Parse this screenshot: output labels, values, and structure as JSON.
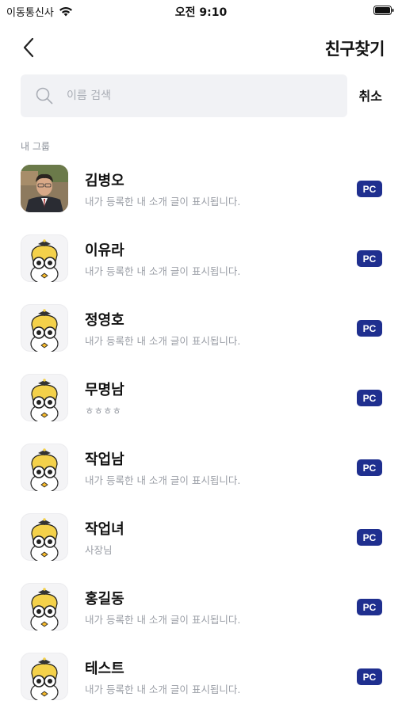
{
  "status_bar": {
    "carrier": "이동통신사",
    "time": "오전 9:10"
  },
  "nav": {
    "title": "친구찾기"
  },
  "search": {
    "placeholder": "이름 검색",
    "value": "",
    "cancel_label": "취소"
  },
  "section_label": "내 그룹",
  "friends": [
    {
      "name": "김병오",
      "intro": "내가 등록한 내 소개 글이 표시됩니다.",
      "badge": "PC",
      "avatar": "photo-avatar"
    },
    {
      "name": "이유라",
      "intro": "내가 등록한 내 소개 글이 표시됩니다.",
      "badge": "PC",
      "avatar": "mascot-avatar"
    },
    {
      "name": "정영호",
      "intro": "내가 등록한 내 소개 글이 표시됩니다.",
      "badge": "PC",
      "avatar": "mascot-avatar"
    },
    {
      "name": "무명남",
      "intro": "ㅎㅎㅎㅎ",
      "badge": "PC",
      "avatar": "mascot-avatar"
    },
    {
      "name": "작업남",
      "intro": "내가 등록한 내 소개 글이 표시됩니다.",
      "badge": "PC",
      "avatar": "mascot-avatar"
    },
    {
      "name": "작업녀",
      "intro": "사장님",
      "badge": "PC",
      "avatar": "mascot-avatar"
    },
    {
      "name": "홍길동",
      "intro": "내가 등록한 내 소개 글이 표시됩니다.",
      "badge": "PC",
      "avatar": "mascot-avatar"
    },
    {
      "name": "테스트",
      "intro": "내가 등록한 내 소개 글이 표시됩니다.",
      "badge": "PC",
      "avatar": "mascot-avatar"
    }
  ],
  "colors": {
    "badge_bg": "#1f2f8f",
    "search_bg": "#f1f2f5",
    "subtext": "#9a9ea6"
  }
}
